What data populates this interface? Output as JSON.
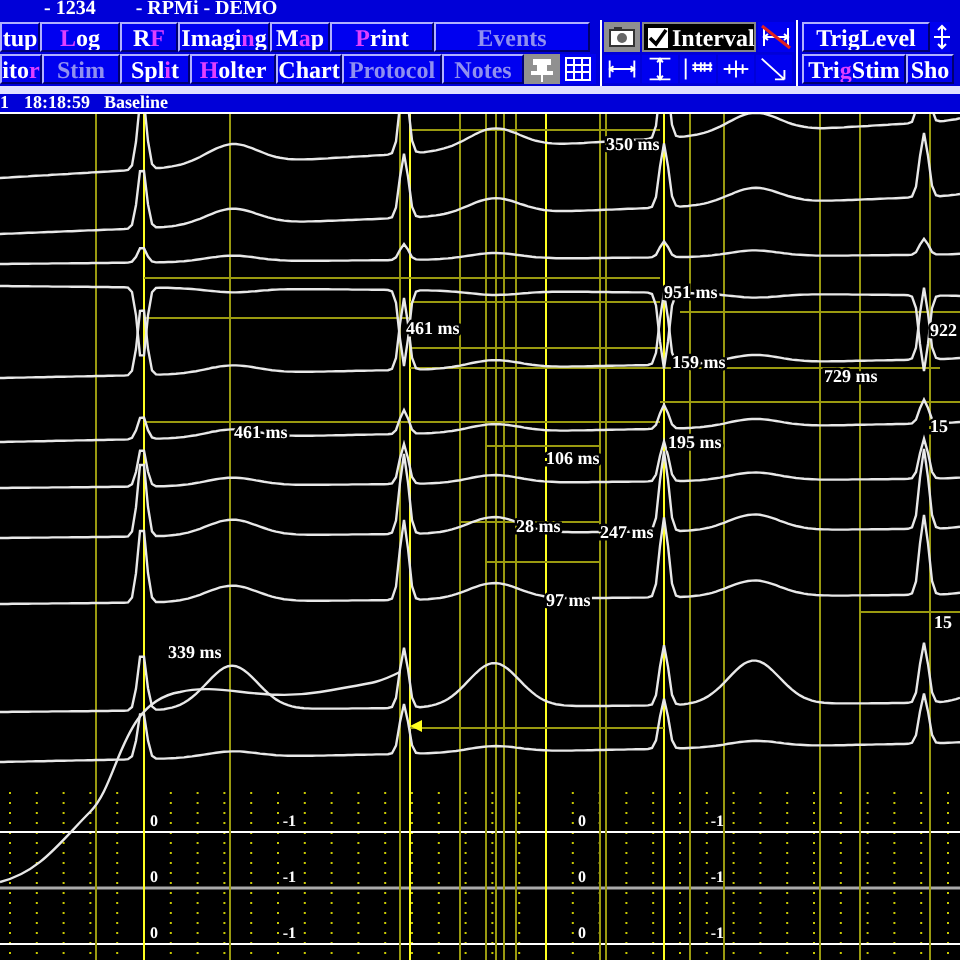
{
  "title_bar": {
    "fields": [
      "- 1234",
      "- RPMi - DEMO"
    ]
  },
  "menu_buttons": {
    "row_1": [
      {
        "before": "tup",
        "disabled": false
      },
      {
        "hotkey": "L",
        "after": "og",
        "disabled": false
      },
      {
        "before": "R",
        "hotkey": "F",
        "disabled": false
      },
      {
        "before": "Imagi",
        "hotkey": "n",
        "after": "g",
        "disabled": false
      },
      {
        "before": "M",
        "hotkey": "a",
        "after": "p",
        "disabled": false
      },
      {
        "hotkey": "P",
        "after": "rint",
        "disabled": false
      },
      {
        "before": "Events",
        "disabled": true
      }
    ],
    "row_2": [
      {
        "before": "ito",
        "hotkey": "r",
        "disabled": false
      },
      {
        "before": "Stim",
        "disabled": true
      },
      {
        "before": "Spl",
        "hotkey": "i",
        "after": "t",
        "disabled": false
      },
      {
        "hotkey": "H",
        "after": "olter",
        "disabled": false
      },
      {
        "before": "Chart",
        "disabled": false
      },
      {
        "before": "Protocol",
        "disabled": true
      },
      {
        "before": "Notes",
        "disabled": true
      }
    ]
  },
  "interval_toggle": {
    "label": "Interval",
    "checked": true
  },
  "trigger_buttons": {
    "row_1": [
      {
        "before": "TrigLevel"
      }
    ],
    "row_2": [
      {
        "before": "Tri",
        "hotkey": "g",
        "after": "Stim"
      },
      {
        "before": "Sho"
      }
    ]
  },
  "status_bar": {
    "channel": "1",
    "time": "18:18:59",
    "phase": "Baseline"
  },
  "recording": {
    "interval_labels": [
      "350 ms",
      "951 ms",
      "461 ms",
      "159 ms",
      "729 ms",
      "922",
      "461 ms",
      "195 ms",
      "106 ms",
      "15",
      "28 ms",
      "247 ms",
      "97 ms",
      "339 ms",
      "15"
    ],
    "scale_rows": [
      [
        "0",
        "-1",
        "0",
        "-1"
      ],
      [
        "0",
        "-1",
        "0",
        "-1"
      ],
      [
        "0",
        "-1",
        "0",
        "-1"
      ]
    ]
  }
}
